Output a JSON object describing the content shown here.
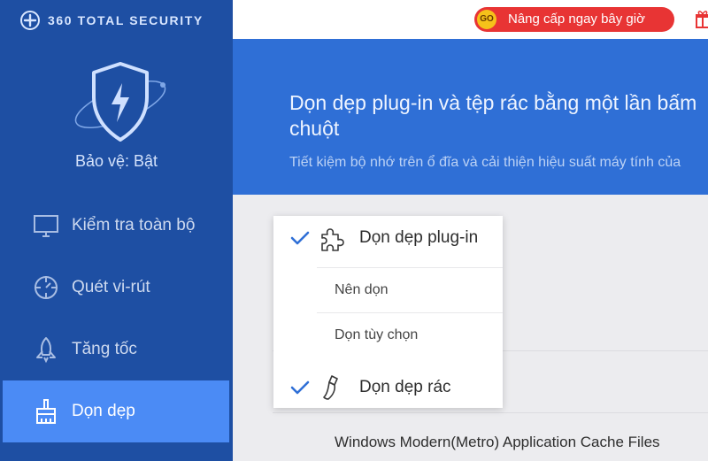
{
  "app": {
    "brand": "360 TOTAL SECURITY",
    "protection_status": "Bảo vệ: Bật"
  },
  "sidebar": {
    "items": [
      {
        "label": "Kiểm tra toàn bộ",
        "icon": "monitor-icon",
        "active": false
      },
      {
        "label": "Quét vi-rút",
        "icon": "crosshair-icon",
        "active": false
      },
      {
        "label": "Tăng tốc",
        "icon": "rocket-icon",
        "active": false
      },
      {
        "label": "Dọn dẹp",
        "icon": "broom-icon",
        "active": true
      }
    ]
  },
  "topbar": {
    "upgrade_badge": "GO",
    "upgrade_label": "Nâng cấp ngay bây giờ"
  },
  "banner": {
    "title": "Dọn dẹp plug-in và tệp rác bằng một lần bấm chuột",
    "subtitle": "Tiết kiệm bộ nhớ trên ổ đĩa và cải thiện hiệu suất máy tính của"
  },
  "content": {
    "row_label": "Windows Modern(Metro) Application Cache Files"
  },
  "dropdown": {
    "plugin": {
      "label": "Dọn dẹp plug-in",
      "checked": true
    },
    "sub_options": [
      "Nên dọn",
      "Dọn tùy chọn"
    ],
    "junk": {
      "label": "Dọn dẹp rác",
      "checked": true
    }
  },
  "colors": {
    "sidebar_bg": "#1e4fa3",
    "sidebar_active": "#4b8bf5",
    "banner_bg": "#2f6fd6",
    "upgrade_red": "#e83434",
    "check_blue": "#2f6fd6"
  }
}
